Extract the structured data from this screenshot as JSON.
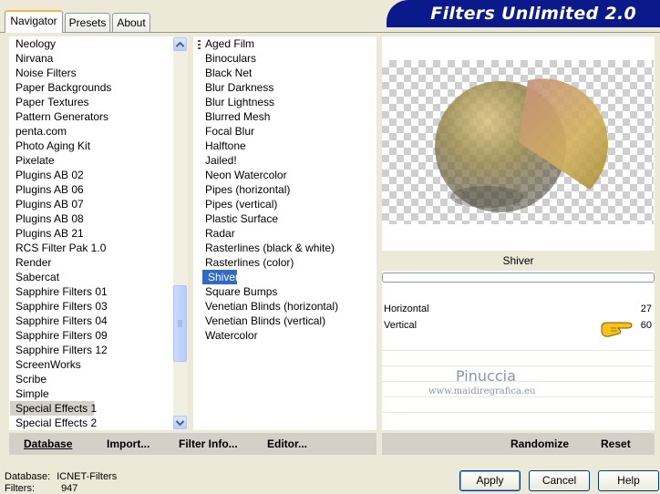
{
  "app": {
    "title": "Filters Unlimited 2.0"
  },
  "tabs": [
    {
      "label": "Navigator",
      "active": true
    },
    {
      "label": "Presets",
      "active": false
    },
    {
      "label": "About",
      "active": false
    }
  ],
  "categories": [
    "Neology",
    "Nirvana",
    "Noise Filters",
    "Paper Backgrounds",
    "Paper Textures",
    "Pattern Generators",
    "penta.com",
    "Photo Aging Kit",
    "Pixelate",
    "Plugins AB 02",
    "Plugins AB 06",
    "Plugins AB 07",
    "Plugins AB 08",
    "Plugins AB 21",
    "RCS Filter Pak 1.0",
    "Render",
    "Sabercat",
    "Sapphire Filters 01",
    "Sapphire Filters 03",
    "Sapphire Filters 04",
    "Sapphire Filters 09",
    "Sapphire Filters 12",
    "ScreenWorks",
    "Scribe",
    "Simple",
    "Special Effects 1",
    "Special Effects 2"
  ],
  "selected_category": "Special Effects 1",
  "filters": [
    "Aged Film",
    "Binoculars",
    "Black Net",
    "Blur Darkness",
    "Blur Lightness",
    "Blurred Mesh",
    "Focal Blur",
    "Halftone",
    "Jailed!",
    "Neon Watercolor",
    "Pipes (horizontal)",
    "Pipes (vertical)",
    "Plastic Surface",
    "Radar",
    "Rasterlines (black & white)",
    "Rasterlines (color)",
    "Shiver",
    "Square Bumps",
    "Venetian Blinds (horizontal)",
    "Venetian Blinds (vertical)",
    "Watercolor"
  ],
  "selected_filter": "Shiver",
  "filter_name": "Shiver",
  "params": [
    {
      "label": "Horizontal",
      "value": "27"
    },
    {
      "label": "Vertical",
      "value": "60"
    }
  ],
  "watermark": {
    "line1": "Pinuccia",
    "line2": "www.maidiregrafica.eu"
  },
  "toolbar_left": {
    "database": "Database",
    "import": "Import...",
    "filter_info": "Filter Info...",
    "editor": "Editor..."
  },
  "toolbar_right": {
    "randomize": "Randomize",
    "reset": "Reset"
  },
  "status": {
    "database_label": "Database:",
    "database_value": "ICNET-Filters",
    "filters_label": "Filters:",
    "filters_value": "947"
  },
  "buttons": {
    "apply": "Apply",
    "cancel": "Cancel",
    "help": "Help"
  },
  "colors": {
    "banner": "#0b1a8a",
    "selection": "#316ac5",
    "accent_tab": "#f7b84b"
  },
  "icons": {
    "pointer": "pointing-hand-icon",
    "grip": "list-grip-icon"
  }
}
